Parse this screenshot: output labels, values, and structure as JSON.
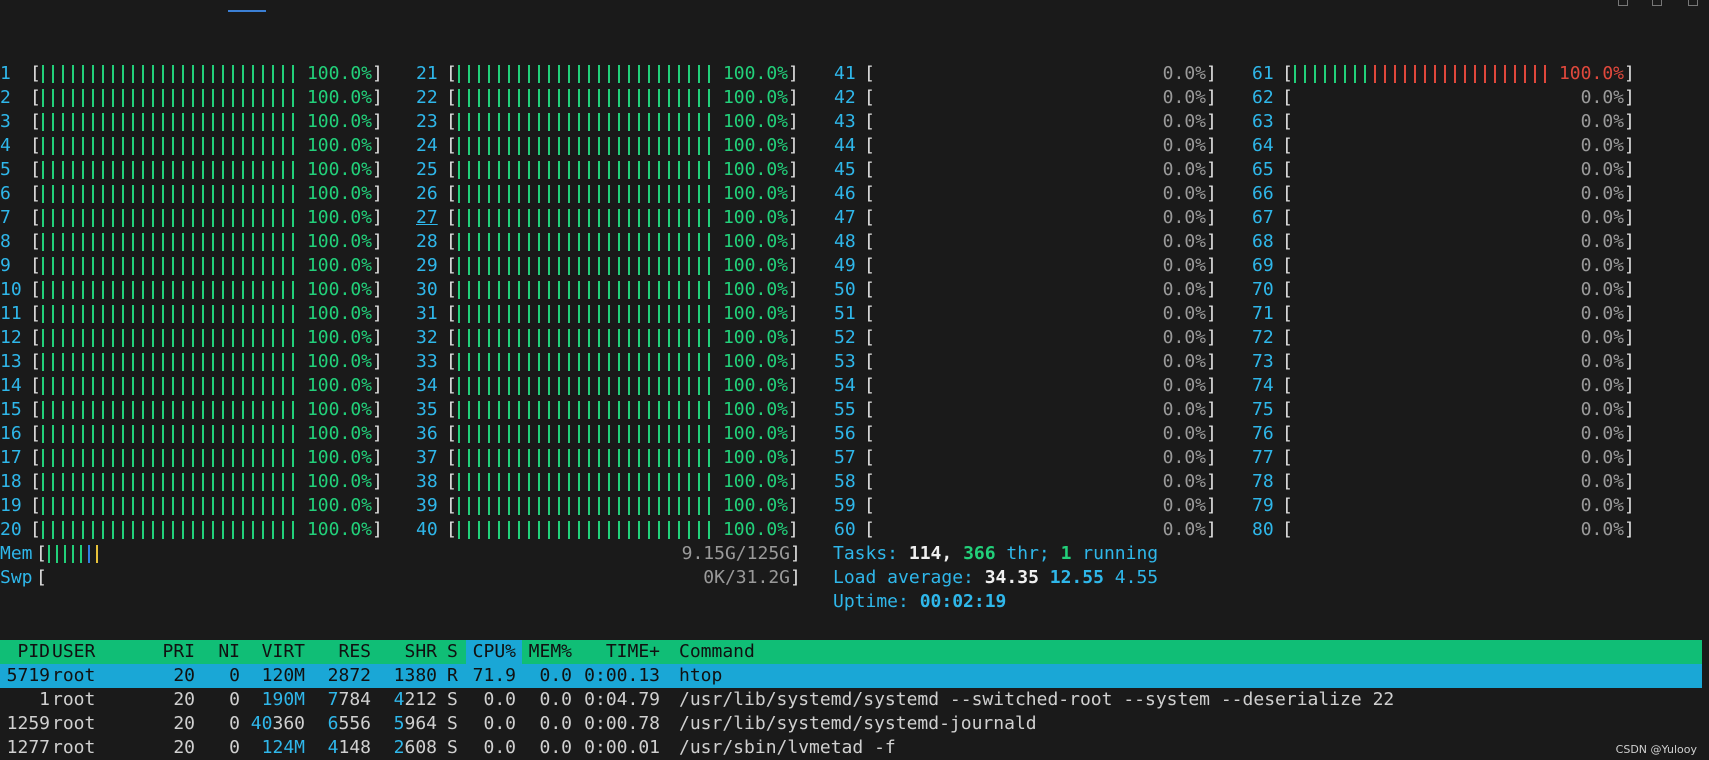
{
  "colors": {
    "background": "#1a1a1a",
    "cpu_number": "#2fb7ea",
    "bar_green": "#22d07a",
    "bar_red": "#e0483c",
    "header_bg": "#10be76",
    "selected_bg": "#1aa7d6",
    "pct_normal": "#9a9a9a"
  },
  "cpu_meters": [
    {
      "id": "1",
      "percent": "100.0%",
      "fill": 1.0
    },
    {
      "id": "2",
      "percent": "100.0%",
      "fill": 1.0
    },
    {
      "id": "3",
      "percent": "100.0%",
      "fill": 1.0
    },
    {
      "id": "4",
      "percent": "100.0%",
      "fill": 1.0
    },
    {
      "id": "5",
      "percent": "100.0%",
      "fill": 1.0
    },
    {
      "id": "6",
      "percent": "100.0%",
      "fill": 1.0
    },
    {
      "id": "7",
      "percent": "100.0%",
      "fill": 1.0
    },
    {
      "id": "8",
      "percent": "100.0%",
      "fill": 1.0
    },
    {
      "id": "9",
      "percent": "100.0%",
      "fill": 1.0
    },
    {
      "id": "10",
      "percent": "100.0%",
      "fill": 1.0
    },
    {
      "id": "11",
      "percent": "100.0%",
      "fill": 1.0
    },
    {
      "id": "12",
      "percent": "100.0%",
      "fill": 1.0
    },
    {
      "id": "13",
      "percent": "100.0%",
      "fill": 1.0
    },
    {
      "id": "14",
      "percent": "100.0%",
      "fill": 1.0
    },
    {
      "id": "15",
      "percent": "100.0%",
      "fill": 1.0
    },
    {
      "id": "16",
      "percent": "100.0%",
      "fill": 1.0
    },
    {
      "id": "17",
      "percent": "100.0%",
      "fill": 1.0
    },
    {
      "id": "18",
      "percent": "100.0%",
      "fill": 1.0
    },
    {
      "id": "19",
      "percent": "100.0%",
      "fill": 1.0
    },
    {
      "id": "20",
      "percent": "100.0%",
      "fill": 1.0
    },
    {
      "id": "21",
      "percent": "100.0%",
      "fill": 1.0
    },
    {
      "id": "22",
      "percent": "100.0%",
      "fill": 1.0
    },
    {
      "id": "23",
      "percent": "100.0%",
      "fill": 1.0
    },
    {
      "id": "24",
      "percent": "100.0%",
      "fill": 1.0
    },
    {
      "id": "25",
      "percent": "100.0%",
      "fill": 1.0
    },
    {
      "id": "26",
      "percent": "100.0%",
      "fill": 1.0
    },
    {
      "id": "27",
      "percent": "100.0%",
      "fill": 1.0,
      "underline": true
    },
    {
      "id": "28",
      "percent": "100.0%",
      "fill": 1.0
    },
    {
      "id": "29",
      "percent": "100.0%",
      "fill": 1.0
    },
    {
      "id": "30",
      "percent": "100.0%",
      "fill": 1.0
    },
    {
      "id": "31",
      "percent": "100.0%",
      "fill": 1.0
    },
    {
      "id": "32",
      "percent": "100.0%",
      "fill": 1.0
    },
    {
      "id": "33",
      "percent": "100.0%",
      "fill": 1.0
    },
    {
      "id": "34",
      "percent": "100.0%",
      "fill": 1.0
    },
    {
      "id": "35",
      "percent": "100.0%",
      "fill": 1.0
    },
    {
      "id": "36",
      "percent": "100.0%",
      "fill": 1.0
    },
    {
      "id": "37",
      "percent": "100.0%",
      "fill": 1.0
    },
    {
      "id": "38",
      "percent": "100.0%",
      "fill": 1.0
    },
    {
      "id": "39",
      "percent": "100.0%",
      "fill": 1.0
    },
    {
      "id": "40",
      "percent": "100.0%",
      "fill": 1.0
    },
    {
      "id": "41",
      "percent": "0.0%",
      "fill": 0
    },
    {
      "id": "42",
      "percent": "0.0%",
      "fill": 0
    },
    {
      "id": "43",
      "percent": "0.0%",
      "fill": 0
    },
    {
      "id": "44",
      "percent": "0.0%",
      "fill": 0
    },
    {
      "id": "45",
      "percent": "0.0%",
      "fill": 0
    },
    {
      "id": "46",
      "percent": "0.0%",
      "fill": 0
    },
    {
      "id": "47",
      "percent": "0.0%",
      "fill": 0
    },
    {
      "id": "48",
      "percent": "0.0%",
      "fill": 0
    },
    {
      "id": "49",
      "percent": "0.0%",
      "fill": 0
    },
    {
      "id": "50",
      "percent": "0.0%",
      "fill": 0
    },
    {
      "id": "51",
      "percent": "0.0%",
      "fill": 0
    },
    {
      "id": "52",
      "percent": "0.0%",
      "fill": 0
    },
    {
      "id": "53",
      "percent": "0.0%",
      "fill": 0
    },
    {
      "id": "54",
      "percent": "0.0%",
      "fill": 0
    },
    {
      "id": "55",
      "percent": "0.0%",
      "fill": 0
    },
    {
      "id": "56",
      "percent": "0.0%",
      "fill": 0
    },
    {
      "id": "57",
      "percent": "0.0%",
      "fill": 0
    },
    {
      "id": "58",
      "percent": "0.0%",
      "fill": 0
    },
    {
      "id": "59",
      "percent": "0.0%",
      "fill": 0
    },
    {
      "id": "60",
      "percent": "0.0%",
      "fill": 0
    },
    {
      "id": "61",
      "percent": "100.0%",
      "fill": 1.0,
      "green_fraction": 0.3,
      "alert": true
    },
    {
      "id": "62",
      "percent": "0.0%",
      "fill": 0
    },
    {
      "id": "63",
      "percent": "0.0%",
      "fill": 0
    },
    {
      "id": "64",
      "percent": "0.0%",
      "fill": 0
    },
    {
      "id": "65",
      "percent": "0.0%",
      "fill": 0
    },
    {
      "id": "66",
      "percent": "0.0%",
      "fill": 0
    },
    {
      "id": "67",
      "percent": "0.0%",
      "fill": 0
    },
    {
      "id": "68",
      "percent": "0.0%",
      "fill": 0
    },
    {
      "id": "69",
      "percent": "0.0%",
      "fill": 0
    },
    {
      "id": "70",
      "percent": "0.0%",
      "fill": 0
    },
    {
      "id": "71",
      "percent": "0.0%",
      "fill": 0
    },
    {
      "id": "72",
      "percent": "0.0%",
      "fill": 0
    },
    {
      "id": "73",
      "percent": "0.0%",
      "fill": 0
    },
    {
      "id": "74",
      "percent": "0.0%",
      "fill": 0
    },
    {
      "id": "75",
      "percent": "0.0%",
      "fill": 0
    },
    {
      "id": "76",
      "percent": "0.0%",
      "fill": 0
    },
    {
      "id": "77",
      "percent": "0.0%",
      "fill": 0
    },
    {
      "id": "78",
      "percent": "0.0%",
      "fill": 0
    },
    {
      "id": "79",
      "percent": "0.0%",
      "fill": 0
    },
    {
      "id": "80",
      "percent": "0.0%",
      "fill": 0
    }
  ],
  "memory": {
    "mem": {
      "label": "Mem",
      "value": "9.15G/125G",
      "fill": 0.07
    },
    "swp": {
      "label": "Swp",
      "value": "0K/31.2G",
      "fill": 0
    }
  },
  "summary": {
    "tasks_label": "Tasks: ",
    "tasks": "114",
    "sep1": ", ",
    "threads": "366",
    "thr_label": " thr; ",
    "running": "1",
    "running_label": " running",
    "load_label": "Load average: ",
    "load1": "34.35",
    "load5": "12.55",
    "load15": "4.55",
    "uptime_label": "Uptime: ",
    "uptime": "00:02:19"
  },
  "process_table": {
    "headers": {
      "pid": "PID",
      "user": "USER",
      "pri": "PRI",
      "ni": "NI",
      "virt": "VIRT",
      "res": "RES",
      "shr": "SHR",
      "s": "S",
      "cpu": "CPU%",
      "mem": "MEM%",
      "time": "TIME+",
      "command": "Command"
    },
    "rows": [
      {
        "pid": "5719",
        "user": "root",
        "pri": "20",
        "ni": "0",
        "virt": "120M",
        "res": "2872",
        "shr": "1380",
        "s": "R",
        "cpu": "71.9",
        "mem": "0.0",
        "time": "0:00.13",
        "command": "htop"
      },
      {
        "pid": "1",
        "user": "root",
        "pri": "20",
        "ni": "0",
        "virt": "190M",
        "res": "7784",
        "shr": "4212",
        "s": "S",
        "cpu": "0.0",
        "mem": "0.0",
        "time": "0:04.79",
        "command": "/usr/lib/systemd/systemd --switched-root --system --deserialize 22"
      },
      {
        "pid": "1259",
        "user": "root",
        "pri": "20",
        "ni": "0",
        "virt": "40360",
        "res": "6556",
        "shr": "5964",
        "s": "S",
        "cpu": "0.0",
        "mem": "0.0",
        "time": "0:00.78",
        "command": "/usr/lib/systemd/systemd-journald"
      },
      {
        "pid": "1277",
        "user": "root",
        "pri": "20",
        "ni": "0",
        "virt": "124M",
        "res": "4148",
        "shr": "2608",
        "s": "S",
        "cpu": "0.0",
        "mem": "0.0",
        "time": "0:00.01",
        "command": "/usr/sbin/lvmetad -f"
      }
    ]
  },
  "watermark": "CSDN @Yulooy"
}
